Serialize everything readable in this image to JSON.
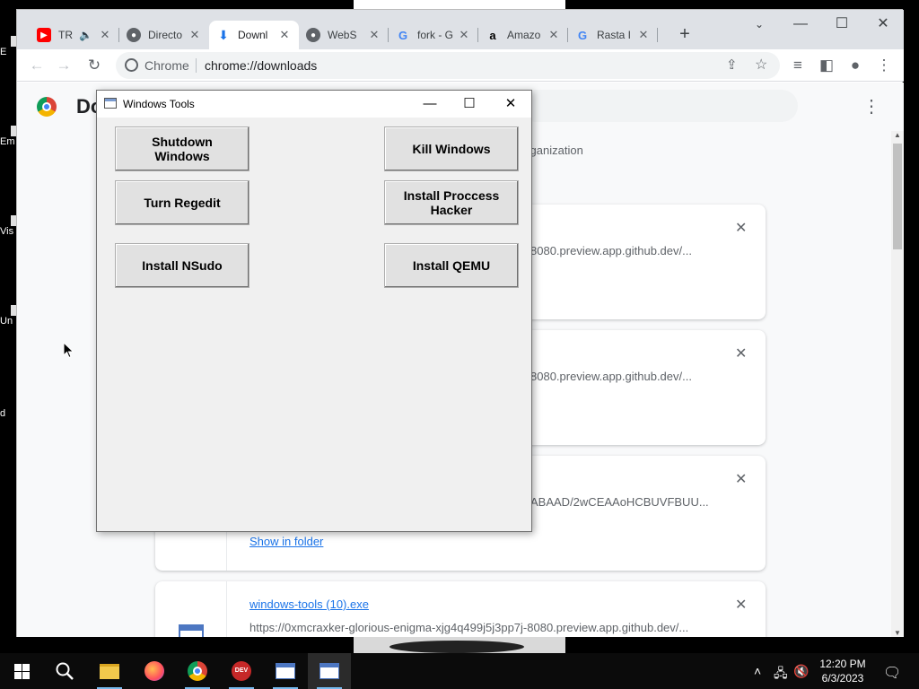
{
  "desktop": {
    "icons": [
      "E",
      "Em D",
      "Vis",
      "Un",
      "d"
    ]
  },
  "browser": {
    "tabs": [
      {
        "label": "TR",
        "favicon": "youtube-icon",
        "color": "#ff0000"
      },
      {
        "label": "Directo",
        "favicon": "globe-icon",
        "color": "#5f6368"
      },
      {
        "label": "Downl",
        "favicon": "download-icon",
        "color": "#1a73e8"
      },
      {
        "label": "WebS",
        "favicon": "globe-icon",
        "color": "#5f6368"
      },
      {
        "label": "fork - G",
        "favicon": "google-icon",
        "color": "#4285f4"
      },
      {
        "label": "Amazo",
        "favicon": "amazon-icon",
        "color": "#000000"
      },
      {
        "label": "Rasta I",
        "favicon": "google-icon",
        "color": "#4285f4"
      }
    ],
    "omnibox": {
      "site": "Chrome",
      "url": "chrome://downloads"
    }
  },
  "downloads": {
    "title": "Downloads",
    "title_visible": "Do",
    "org_message": "organization",
    "items": [
      {
        "name": "",
        "url": "8080.preview.app.github.dev/...",
        "action": ""
      },
      {
        "name": "",
        "url": "8080.preview.app.github.dev/...",
        "action": ""
      },
      {
        "name": "",
        "url": "ABAAD/2wCEAAoHCBUVFBUU...",
        "action": "Show in folder"
      },
      {
        "name": "windows-tools (10).exe",
        "url": "https://0xmcraxker-glorious-enigma-xjg4q499j5j3pp7j-8080.preview.app.github.dev/...",
        "action": ""
      }
    ]
  },
  "windows_tools": {
    "title": "Windows Tools",
    "buttons": {
      "shutdown": "Shutdown Windows",
      "kill": "Kill Windows",
      "regedit": "Turn Regedit",
      "process_hacker": "Install Proccess Hacker",
      "nsudo": "Install NSudo",
      "qemu": "Install QEMU"
    }
  },
  "taskbar": {
    "time": "12:20 PM",
    "date": "6/3/2023",
    "apps": [
      "start",
      "search",
      "file-explorer",
      "firefox",
      "chrome",
      "dev-cpp",
      "windows-tools",
      "windows-tools"
    ]
  }
}
